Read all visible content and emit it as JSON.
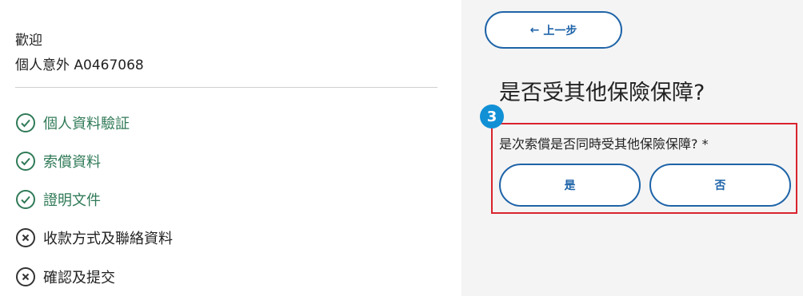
{
  "sidebar": {
    "welcome": "歡迎",
    "policy": "個人意外 A0467068",
    "steps": [
      {
        "label": "個人資料驗証",
        "status": "done"
      },
      {
        "label": "索償資料",
        "status": "done"
      },
      {
        "label": "證明文件",
        "status": "done"
      },
      {
        "label": "收款方式及聯絡資料",
        "status": "todo"
      },
      {
        "label": "確認及提交",
        "status": "todo"
      }
    ]
  },
  "main": {
    "back_label": "上一步",
    "question_title": "是否受其他保險保障?",
    "step_badge": "3",
    "sub_question": "是次索償是否同時受其他保險保障? *",
    "options": {
      "yes": "是",
      "no": "否"
    }
  },
  "colors": {
    "done_green": "#2f7a57",
    "primary_blue": "#1e63a8",
    "badge_blue": "#1190d6",
    "highlight_red": "#d9232d"
  }
}
